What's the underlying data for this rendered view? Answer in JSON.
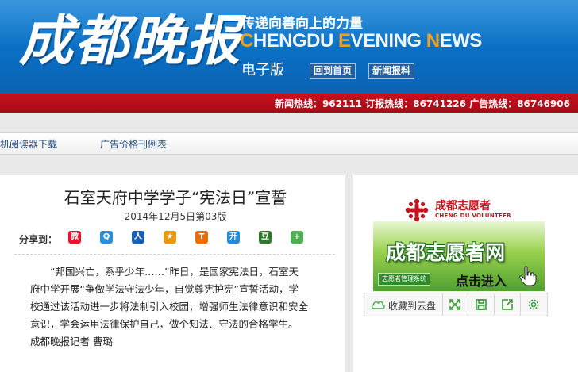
{
  "header": {
    "logo": "成都晚报",
    "slogan": "传递向善向上的力量",
    "english_name": "CHENGDU EVENING NEWS",
    "edition_label": "电子版",
    "buttons": [
      "回到首页",
      "新闻报料"
    ]
  },
  "hotlines": "新闻热线：962111 订报热线：86741226 广告热线：86746906",
  "nav": {
    "links": [
      "机阅读器下载",
      "广告价格刊例表"
    ]
  },
  "article": {
    "title": "石室天府中学学子“宪法日”宣誓",
    "dateline": "2014年12月5日第03版",
    "share_label": "分享到：",
    "share_icons": [
      {
        "name": "weibo-icon",
        "glyph": "微",
        "color": "#e6162d"
      },
      {
        "name": "qq-weibo-icon",
        "glyph": "Q",
        "color": "#2f8fd6"
      },
      {
        "name": "renren-icon",
        "glyph": "人",
        "color": "#1a5fb4"
      },
      {
        "name": "qzone-icon",
        "glyph": "★",
        "color": "#e59a12"
      },
      {
        "name": "tianya-icon",
        "glyph": "T",
        "color": "#ef6c00"
      },
      {
        "name": "kaixin-icon",
        "glyph": "开",
        "color": "#2a8ad6"
      },
      {
        "name": "douban-icon",
        "glyph": "豆",
        "color": "#2d7a2d"
      },
      {
        "name": "more-share-icon",
        "glyph": "+",
        "color": "#4caf50"
      }
    ],
    "body": "“邦国兴亡，系乎少年……”昨日，是国家宪法日，石室天府中学开展“争做学法守法少年，自觉尊宪护宪”宣誓活动，学校通过该活动进一步将法制引入校园，增强师生法律意识和安全意识，学会运用法律保护自己，做个知法、守法的合格学生。 成都晚报记者 曹璐"
  },
  "sidebar": {
    "ad": {
      "org_cn": "成都志愿者",
      "org_en": "CHENG DU VOLUNTEER",
      "headline": "成都志愿者网",
      "system_label": "志愿者管理系统",
      "cta": "点击进入"
    },
    "toolbar": {
      "cloud_label": "收藏到云盘",
      "icons": [
        "expand-icon",
        "save-icon",
        "share-out-icon",
        "settings-icon"
      ]
    }
  },
  "colors": {
    "header_blue": "#0a6fc3",
    "hotline_red": "#b50d19",
    "link_blue": "#1d4a7b",
    "accent_orange": "#f0a020"
  }
}
